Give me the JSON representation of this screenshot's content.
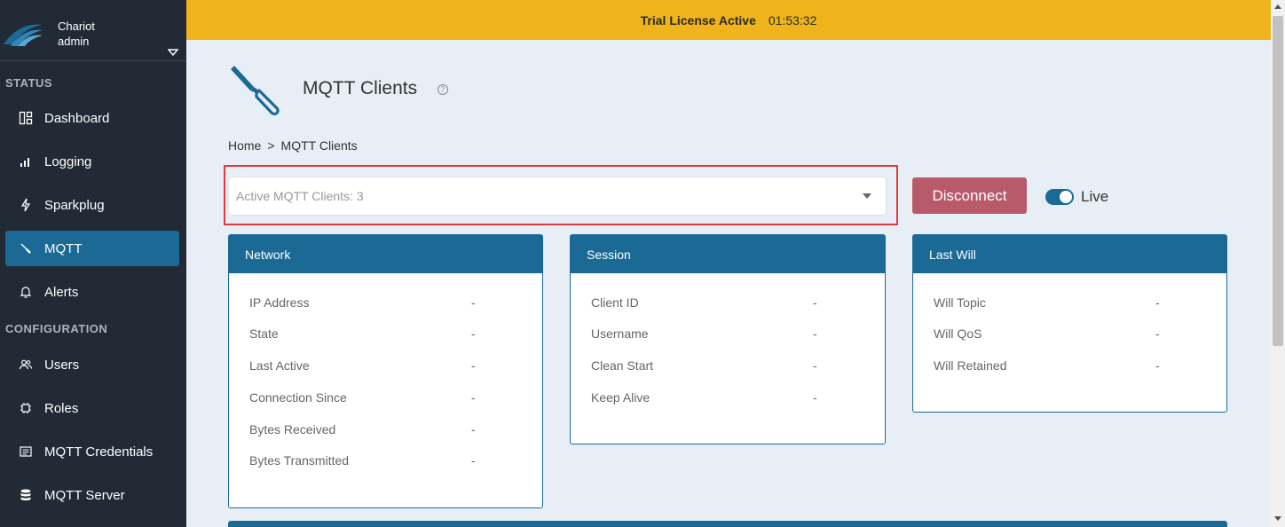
{
  "brand": {
    "name": "Chariot",
    "user": "admin"
  },
  "sidebar": {
    "sections": [
      "STATUS",
      "CONFIGURATION"
    ],
    "items": [
      {
        "label": "Dashboard",
        "icon": "dashboard-icon"
      },
      {
        "label": "Logging",
        "icon": "bar-chart-icon"
      },
      {
        "label": "Sparkplug",
        "icon": "lightning-icon"
      },
      {
        "label": "MQTT",
        "icon": "screwdriver-icon",
        "active": true
      },
      {
        "label": "Alerts",
        "icon": "bell-icon"
      },
      {
        "label": "Users",
        "icon": "users-icon"
      },
      {
        "label": "Roles",
        "icon": "chip-icon"
      },
      {
        "label": "MQTT Credentials",
        "icon": "document-icon"
      },
      {
        "label": "MQTT Server",
        "icon": "database-icon"
      }
    ]
  },
  "banner": {
    "status": "Trial License Active",
    "timer": "01:53:32",
    "color": "#efb41b"
  },
  "page": {
    "title": "MQTT Clients",
    "help": "?"
  },
  "breadcrumb": {
    "home": "Home",
    "separator": ">",
    "current": "MQTT Clients"
  },
  "selector": {
    "value": "Active MQTT Clients: 3"
  },
  "actions": {
    "disconnect": "Disconnect",
    "live": "Live",
    "live_on": true
  },
  "cards": {
    "network": {
      "title": "Network",
      "rows": [
        {
          "label": "IP Address",
          "value": "-"
        },
        {
          "label": "State",
          "value": "-"
        },
        {
          "label": "Last Active",
          "value": "-"
        },
        {
          "label": "Connection Since",
          "value": "-"
        },
        {
          "label": "Bytes Received",
          "value": "-"
        },
        {
          "label": "Bytes Transmitted",
          "value": "-"
        }
      ]
    },
    "session": {
      "title": "Session",
      "rows": [
        {
          "label": "Client ID",
          "value": "-"
        },
        {
          "label": "Username",
          "value": "-"
        },
        {
          "label": "Clean Start",
          "value": "-"
        },
        {
          "label": "Keep Alive",
          "value": "-"
        }
      ]
    },
    "lastwill": {
      "title": "Last Will",
      "rows": [
        {
          "label": "Will Topic",
          "value": "-"
        },
        {
          "label": "Will QoS",
          "value": "-"
        },
        {
          "label": "Will Retained",
          "value": "-"
        }
      ]
    }
  },
  "colors": {
    "primary": "#1b6a96",
    "sidebar": "#222b35",
    "danger": "#b95a6a",
    "highlight": "#e0393e"
  }
}
